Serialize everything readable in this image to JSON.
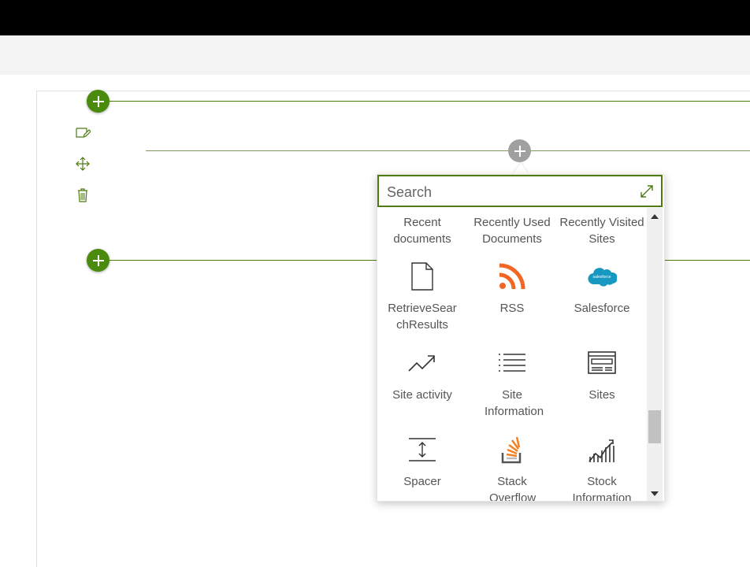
{
  "colors": {
    "accent": "#4a8a0c",
    "rss": "#f26522",
    "salesforce": "#1798c1",
    "stackoverflow": "#f48024"
  },
  "search": {
    "placeholder": "Search"
  },
  "toolbox": {
    "items": [
      {
        "label": "Recent documents",
        "icon": "none"
      },
      {
        "label": "Recently Used Documents",
        "icon": "none"
      },
      {
        "label": "Recently Visited Sites",
        "icon": "none"
      },
      {
        "label": "RetrieveSearchResults",
        "icon": "document-icon"
      },
      {
        "label": "RSS",
        "icon": "rss-icon"
      },
      {
        "label": "Salesforce",
        "icon": "salesforce-icon"
      },
      {
        "label": "Site activity",
        "icon": "trending-icon"
      },
      {
        "label": "Site Information",
        "icon": "list-icon"
      },
      {
        "label": "Sites",
        "icon": "sites-icon"
      },
      {
        "label": "Spacer",
        "icon": "spacer-icon"
      },
      {
        "label": "Stack Overflow",
        "icon": "stackoverflow-icon"
      },
      {
        "label": "Stock Information",
        "icon": "stock-chart-icon"
      }
    ],
    "salesforce_logo_text": "salesforce"
  }
}
